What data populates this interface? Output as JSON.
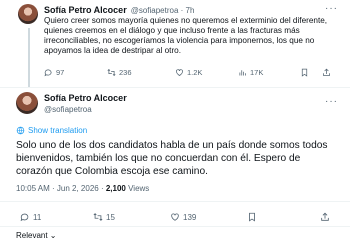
{
  "top_tweet": {
    "display_name": "Sofía Petro Alcocer",
    "handle_time": "@sofiapetroa · 7h",
    "text": "Quiero creer somos mayoría quienes no queremos el exterminio del diferente, quienes creemos en el diálogo y que incluso frente a las fracturas más irreconciliables, no escogeríamos la violencia para imponernos, los que no apoyamos la idea de destripar al otro.",
    "more": "···",
    "actions": {
      "replies": "97",
      "retweets": "236",
      "likes": "1.2K",
      "views": "17K"
    }
  },
  "main_tweet": {
    "display_name": "Sofía Petro Alcocer",
    "handle": "@sofiapetroa",
    "more": "···",
    "show_translation": "Show translation",
    "text": "Solo uno de los dos candidatos habla de un país donde somos todos bienvenidos, también los que no concuerdan con él. Espero de corazón que Colombia escoja ese camino.",
    "timestamp": "10:05 AM · Jun 2, 2026 · ",
    "views_count": "2,100",
    "views_label": " Views",
    "actions": {
      "replies": "11",
      "retweets": "15",
      "likes": "139"
    }
  },
  "footer": {
    "relevant_label": "Relevant ⌄"
  },
  "colors": {
    "accent": "#1d9bf0",
    "text": "#0f1419",
    "muted": "#536471"
  }
}
